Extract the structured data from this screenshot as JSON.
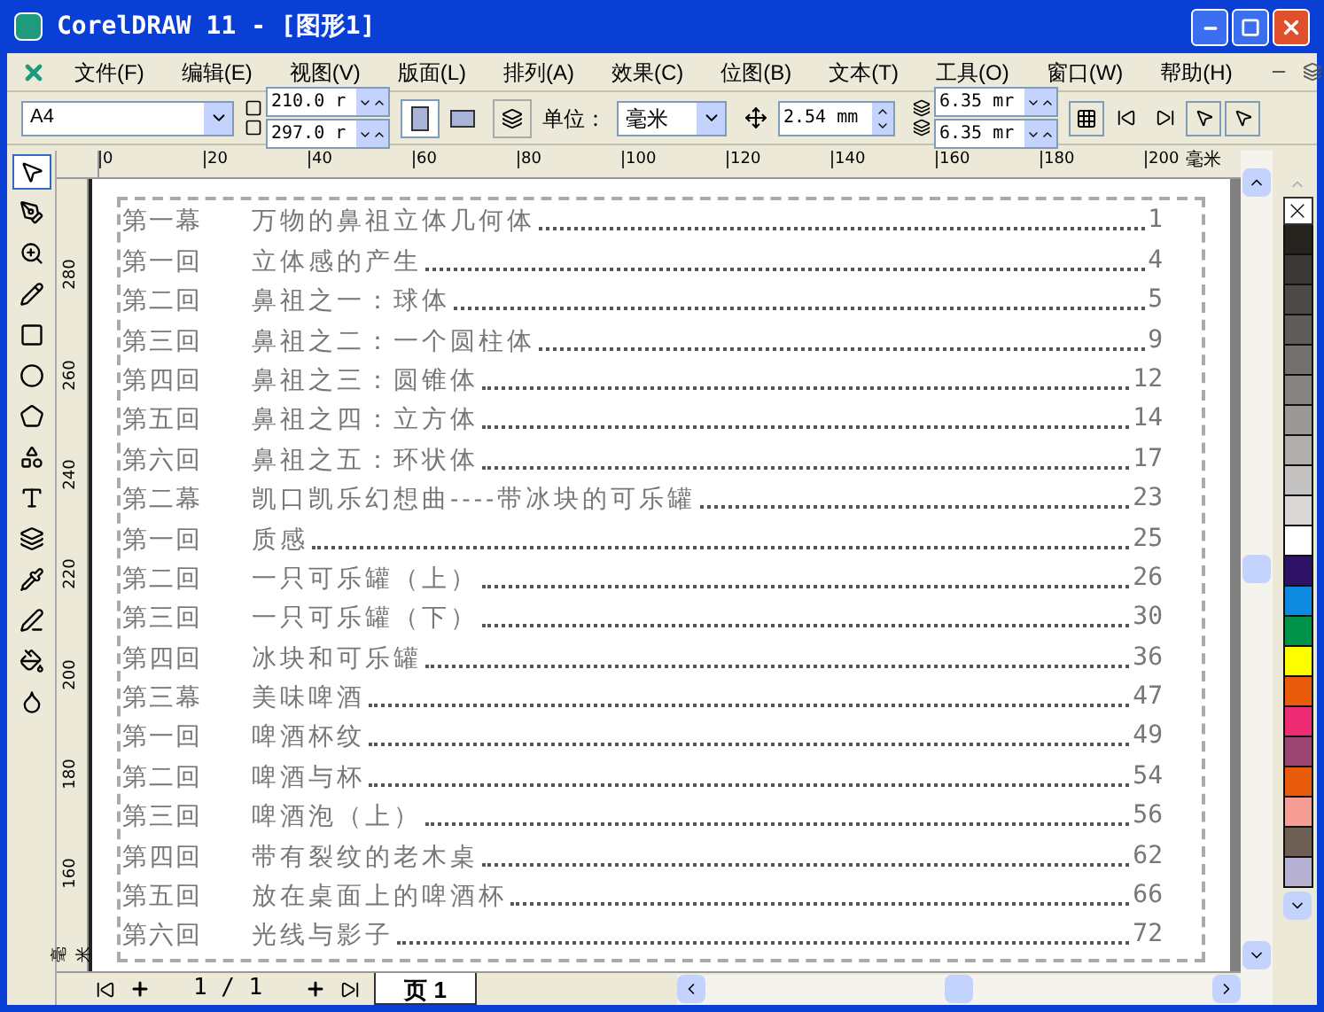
{
  "window": {
    "title": "CorelDRAW 11 - [图形1]"
  },
  "menu": [
    "文件(F)",
    "编辑(E)",
    "视图(V)",
    "版面(L)",
    "排列(A)",
    "效果(C)",
    "位图(B)",
    "文本(T)",
    "工具(O)",
    "窗口(W)",
    "帮助(H)"
  ],
  "property_bar": {
    "paper": "A4",
    "width": "210.0 r",
    "height": "297.0 r",
    "orientation": [
      {
        "selected": true
      },
      {
        "selected": false
      }
    ],
    "unit_label": "单位：",
    "unit": "毫米",
    "nudge": "2.54 mm",
    "dup_x": "6.35 mr",
    "dup_y": "6.35 mr"
  },
  "tools": [
    {
      "selected": true
    },
    {
      "selected": false
    },
    {
      "selected": false
    },
    {
      "selected": false
    },
    {
      "selected": false
    },
    {
      "selected": false
    },
    {
      "selected": false
    },
    {
      "selected": false
    },
    {
      "selected": false
    },
    {
      "selected": false
    },
    {
      "selected": false
    },
    {
      "selected": false
    },
    {
      "selected": false
    },
    {
      "selected": false
    }
  ],
  "ruler": {
    "h_labels": [
      "0",
      "20",
      "40",
      "60",
      "80",
      "100",
      "120",
      "140",
      "160",
      "180",
      "200"
    ],
    "h_unit": "毫米",
    "v_labels": [
      "280",
      "260",
      "240",
      "220",
      "200",
      "180",
      "160"
    ],
    "v_unit": "毫米"
  },
  "toc": [
    {
      "label": "第一幕",
      "title": "万物的鼻祖立体几何体",
      "page": "1"
    },
    {
      "label": "第一回",
      "title": "立体感的产生",
      "page": "4"
    },
    {
      "label": "第二回",
      "title": "鼻祖之一：球体",
      "page": "5"
    },
    {
      "label": "第三回",
      "title": "鼻祖之二：一个圆柱体",
      "page": "9"
    },
    {
      "label": "第四回",
      "title": "鼻祖之三：圆锥体",
      "page": "12"
    },
    {
      "label": "第五回",
      "title": "鼻祖之四：立方体",
      "page": "14"
    },
    {
      "label": "第六回",
      "title": "鼻祖之五：环状体",
      "page": "17"
    },
    {
      "label": "第二幕",
      "title": "凯口凯乐幻想曲----带冰块的可乐罐",
      "page": "23"
    },
    {
      "label": "第一回",
      "title": "质感",
      "page": "25"
    },
    {
      "label": "第二回",
      "title": "一只可乐罐（上）",
      "page": "26"
    },
    {
      "label": "第三回",
      "title": "一只可乐罐（下）",
      "page": "30"
    },
    {
      "label": "第四回",
      "title": "冰块和可乐罐",
      "page": "36"
    },
    {
      "label": "第三幕",
      "title": "美味啤酒",
      "page": "47"
    },
    {
      "label": "第一回",
      "title": "啤酒杯纹",
      "page": "49"
    },
    {
      "label": "第二回",
      "title": "啤酒与杯",
      "page": "54"
    },
    {
      "label": "第三回",
      "title": "啤酒泡（上）",
      "page": "56"
    },
    {
      "label": "第四回",
      "title": "带有裂纹的老木桌",
      "page": "62"
    },
    {
      "label": "第五回",
      "title": "放在桌面上的啤酒杯",
      "page": "66"
    },
    {
      "label": "第六回",
      "title": "光线与影子",
      "page": "72"
    }
  ],
  "palette": [
    {
      "color": "#27231f"
    },
    {
      "color": "#3b3835"
    },
    {
      "color": "#4c4946"
    },
    {
      "color": "#5f5c59"
    },
    {
      "color": "#73706d"
    },
    {
      "color": "#868380"
    },
    {
      "color": "#9b9896"
    },
    {
      "color": "#b0adab"
    },
    {
      "color": "#c4c2c0"
    },
    {
      "color": "#dad8d6"
    },
    {
      "color": "#ffffff"
    },
    {
      "color": "#2e1267"
    },
    {
      "color": "#0e8ae0"
    },
    {
      "color": "#00934a"
    },
    {
      "color": "#ffff00"
    },
    {
      "color": "#ea5b0c"
    },
    {
      "color": "#ee2c74"
    },
    {
      "color": "#9a4471"
    },
    {
      "color": "#e95a0c"
    },
    {
      "color": "#f69d96"
    },
    {
      "color": "#6d5f54"
    },
    {
      "color": "#b7b1d4"
    }
  ],
  "page_nav": {
    "counter": "1 / 1",
    "tabs": [
      {
        "label": "页 1",
        "selected": true
      }
    ]
  }
}
